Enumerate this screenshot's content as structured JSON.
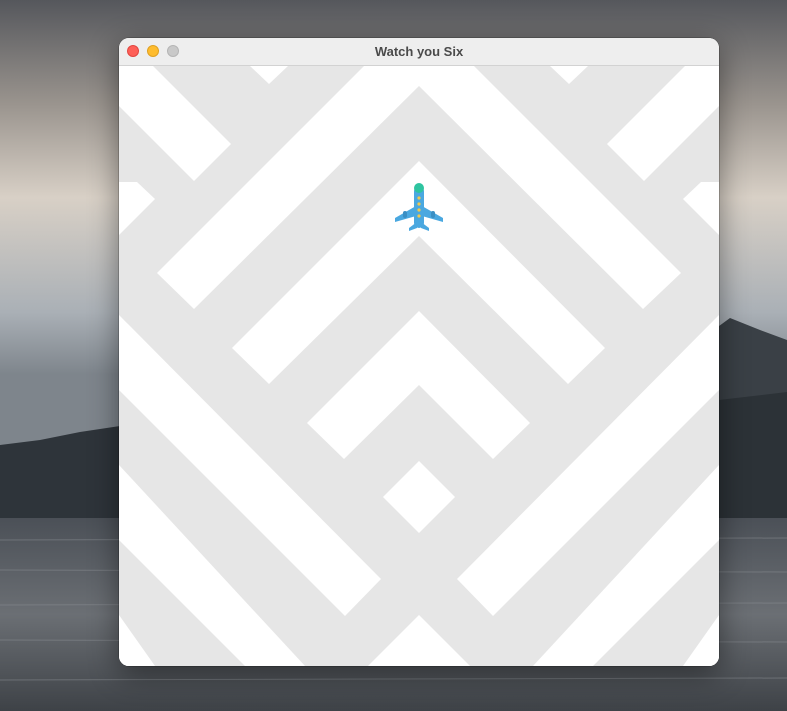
{
  "window": {
    "title": "Watch you Six",
    "controls": {
      "close": "close-button",
      "minimize": "minimize-button",
      "zoom": "zoom-button"
    }
  },
  "colors": {
    "pattern_stripe": "#e6e6e6",
    "pattern_background": "#ffffff",
    "plane_body": "#4aa8e0",
    "plane_nose": "#2ec4a0",
    "plane_windows": "#f2c94c"
  },
  "game": {
    "player_icon": "airplane-icon"
  }
}
